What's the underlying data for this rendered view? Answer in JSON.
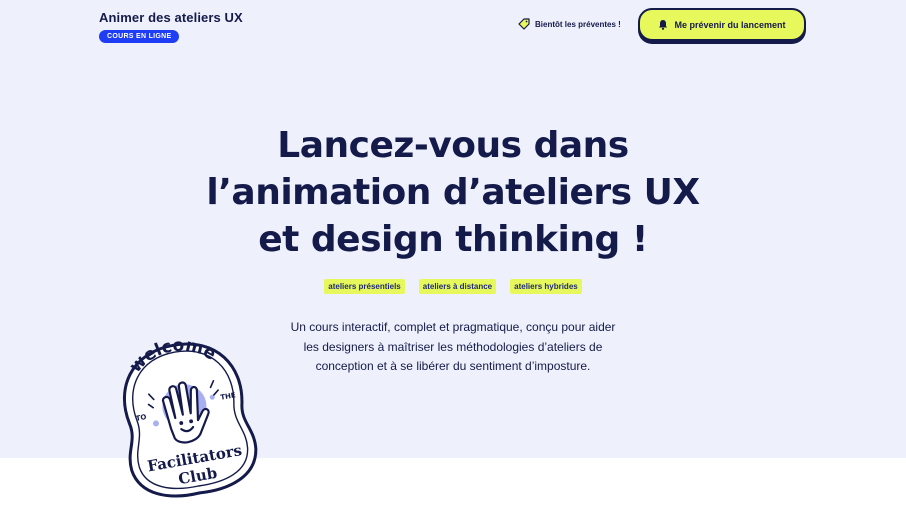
{
  "header": {
    "brand_title": "Animer des ateliers UX",
    "brand_badge": "COURS EN LIGNE",
    "presale_text": "Bientôt les préventes !",
    "notify_label": "Me prévenir du lancement"
  },
  "hero": {
    "title_lines": [
      "Lancez-vous dans",
      "l’animation d’ateliers UX",
      "et design thinking !"
    ],
    "tags": [
      "ateliers présentiels",
      "ateliers à distance",
      "ateliers hybrides"
    ],
    "intro_lines": [
      "Un cours interactif, complet et pragmatique, conçu pour aider",
      "les designers à maîtriser les méthodologies d’ateliers de",
      "conception et à se libérer du sentiment d’imposture."
    ]
  },
  "sticker": {
    "welcome": "welcome",
    "to": "TO",
    "the": "THE",
    "line1": "Facilitators",
    "line2": "Club"
  },
  "colors": {
    "navy": "#141a4a",
    "lime": "#e7f85c",
    "blue": "#1e3df5",
    "lavender": "#a9b0f2",
    "background": "#eef1fb"
  },
  "icons": {
    "presale": "price-tag-icon",
    "notify": "bell-icon"
  }
}
